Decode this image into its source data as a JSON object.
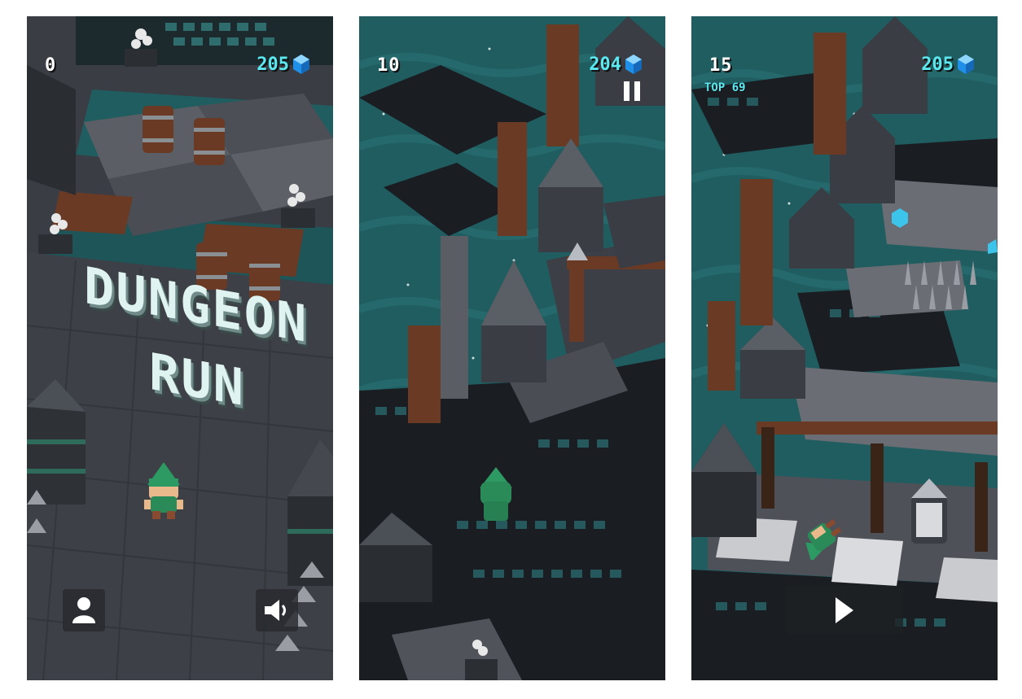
{
  "screens": [
    {
      "score": "0",
      "gems": "205",
      "title_line1": "DUNGEON",
      "title_line2": "RUN",
      "icons": {
        "gem": "gem-icon",
        "profile": "person-icon",
        "sound": "speaker-icon"
      }
    },
    {
      "score": "10",
      "gems": "204",
      "icons": {
        "gem": "gem-icon",
        "pause": "pause-icon"
      }
    },
    {
      "score": "15",
      "top_label": "TOP 69",
      "gems": "205",
      "icons": {
        "gem": "gem-icon",
        "play": "play-icon"
      }
    }
  ],
  "colors": {
    "gem_text": "#5ce8f0",
    "gem_blue": "#1f8fe8",
    "water": "#1f5d60",
    "floor": "#3e4147",
    "title_text": "#dff4f1",
    "hero_green": "#2e9a63"
  }
}
